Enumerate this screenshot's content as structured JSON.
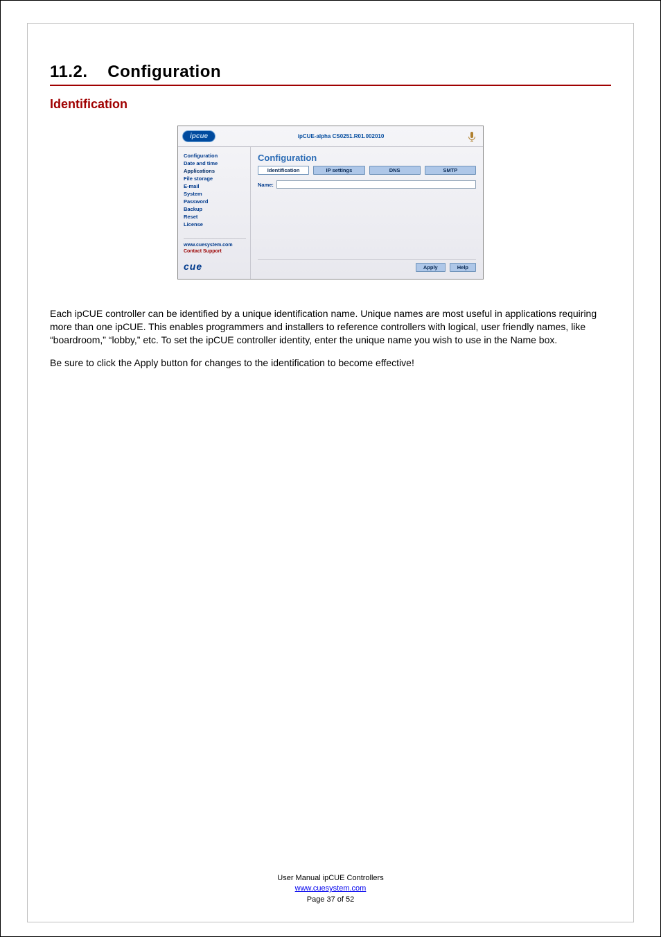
{
  "section_number": "11.2.",
  "section_title": "Configuration",
  "subsection_title": "Identification",
  "screenshot": {
    "logo_text": "ipcue",
    "header_title": "ipCUE-alpha   CS0251.R01.002010",
    "sidebar": {
      "items": [
        {
          "label": "Configuration"
        },
        {
          "label": "Date and time"
        },
        {
          "label": "Applications"
        },
        {
          "label": "File storage"
        },
        {
          "label": "E-mail"
        },
        {
          "label": "System"
        },
        {
          "label": "Password"
        },
        {
          "label": "Backup"
        },
        {
          "label": "Reset"
        },
        {
          "label": "License"
        }
      ],
      "link": "www.cuesystem.com",
      "support": "Contact Support",
      "brand": "cue"
    },
    "main": {
      "title": "Configuration",
      "tabs": [
        {
          "label": "Identification",
          "active": true
        },
        {
          "label": "IP settings",
          "active": false
        },
        {
          "label": "DNS",
          "active": false
        },
        {
          "label": "SMTP",
          "active": false
        }
      ],
      "name_label": "Name:",
      "name_value": "",
      "buttons": {
        "apply": "Apply",
        "help": "Help"
      }
    }
  },
  "paragraph1": "Each ipCUE controller can be identified by a unique identification name. Unique names are most useful in applications requiring more than one ipCUE. This enables programmers and installers to reference controllers with logical, user friendly names, like “boardroom,” “lobby,” etc. To set the ipCUE controller identity, enter the unique name you wish to use in the Name box.",
  "paragraph2": "Be sure to click the Apply button for changes to the identification to become effective!",
  "footer": {
    "line1": "User Manual ipCUE Controllers",
    "link_text": "www.cuesystem.com",
    "page_line": "Page 37 of 52"
  }
}
